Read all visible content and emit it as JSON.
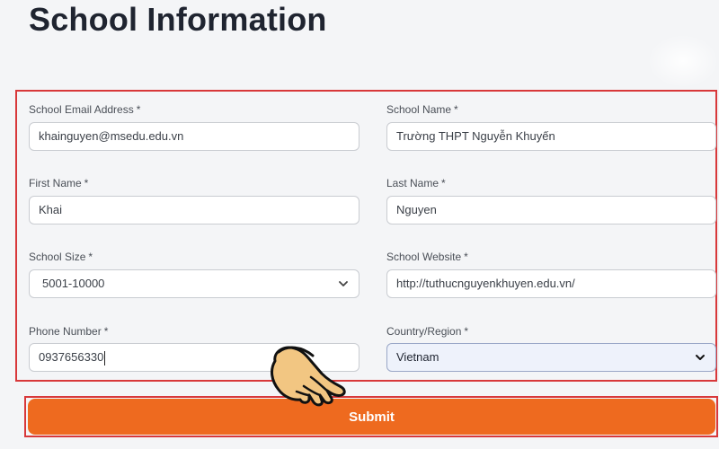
{
  "page": {
    "title": "School Information"
  },
  "form": {
    "school_email": {
      "label": "School Email Address",
      "value": "khainguyen@msedu.edu.vn"
    },
    "school_name": {
      "label": "School Name",
      "value": "Trường THPT Nguyễn Khuyến"
    },
    "first_name": {
      "label": "First Name",
      "value": "Khai"
    },
    "last_name": {
      "label": "Last Name",
      "value": "Nguyen"
    },
    "school_size": {
      "label": "School Size",
      "value": "5001-10000"
    },
    "school_website": {
      "label": "School Website",
      "value": "http://tuthucnguyenkhuyen.edu.vn/"
    },
    "phone": {
      "label": "Phone Number",
      "value": "0937656330"
    },
    "country": {
      "label": "Country/Region",
      "value": "Vietnam"
    },
    "required_mark": "*"
  },
  "submit": {
    "label": "Submit"
  },
  "colors": {
    "accent": "#ee6a1f",
    "highlight_border": "#d8383a",
    "focused_field": "#eef2fb"
  },
  "icons": {
    "select_arrow": "chevron-down-icon",
    "pointer": "pointing-hand-icon"
  }
}
